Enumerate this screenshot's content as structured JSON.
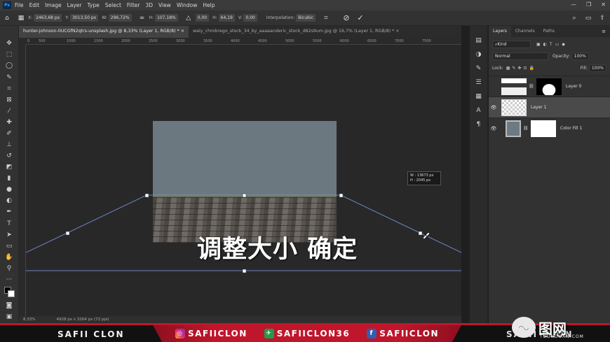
{
  "menubar": {
    "logo": "Ps",
    "items": [
      "File",
      "Edit",
      "Image",
      "Layer",
      "Type",
      "Select",
      "Filter",
      "3D",
      "View",
      "Window",
      "Help"
    ]
  },
  "options": {
    "x_label": "X:",
    "x_value": "2463,68 px",
    "y_label": "Y:",
    "y_value": "3013,50 px",
    "w_label": "W:",
    "w_value": "296,72%",
    "h_label": "H:",
    "h_value": "107,18%",
    "angle_value": "0,00",
    "hskew_label": "H:",
    "hskew_value": "64,19",
    "vskew_label": "V:",
    "vskew_value": "0,00",
    "interp_label": "Interpolation:",
    "interp_value": "Bicubic"
  },
  "tabs": [
    {
      "label": "hunter-johnson-0UCGfN2qtrs-unsplash.jpg @ 8,33% (Layer 1, RGB/8) * ×",
      "active": true
    },
    {
      "label": "waly_chrobrego_stock_34_by_aaaaanderic_stock_d82s9um.jpg @ 16,7% (Layer 1, RGB/8) * ×",
      "active": false
    }
  ],
  "ruler": {
    "ticks": [
      "0",
      "500",
      "1000",
      "1500",
      "2000",
      "2500",
      "3000",
      "3500",
      "4000",
      "4500",
      "5000",
      "5500",
      "6000",
      "6500",
      "7000",
      "7500"
    ]
  },
  "transform_tip": {
    "w": "W : 13673 px",
    "h": "H : 2045 px"
  },
  "subtitle": "调整大小 确定",
  "status": {
    "zoom": "8,33%",
    "doc": "4928 px x 3264 px (72 ppi)"
  },
  "layers_panel": {
    "tabs": [
      "Layers",
      "Channels",
      "Paths"
    ],
    "kind": "Kind",
    "blend": "Normal",
    "opacity_label": "Opacity:",
    "opacity": "100%",
    "lock_label": "Lock:",
    "fill_label": "Fill:",
    "fill": "100%",
    "layers": [
      {
        "name": "Layer 0",
        "visible": false,
        "selected": false
      },
      {
        "name": "Layer 1",
        "visible": true,
        "selected": true
      },
      {
        "name": "Color Fill 1",
        "visible": true,
        "selected": false
      }
    ]
  },
  "footer": {
    "brand": "SAFII CLON",
    "social": [
      {
        "icon": "instagram-icon",
        "handle": "SAFIICLON"
      },
      {
        "icon": "telegram-icon",
        "handle": "SAFIICLON36"
      },
      {
        "icon": "facebook-icon",
        "handle": "SAFIICLON"
      }
    ],
    "right": "SAFII CLON"
  },
  "watermark": {
    "text": "图网",
    "url": "TUUNDOAN.COM"
  }
}
